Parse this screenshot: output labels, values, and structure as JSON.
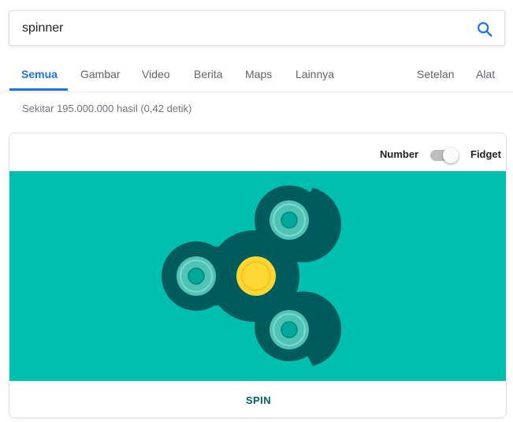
{
  "search": {
    "query": "spinner",
    "button_icon": "search-icon"
  },
  "tabs": [
    {
      "label": "Semua",
      "active": true
    },
    {
      "label": "Gambar"
    },
    {
      "label": "Video"
    },
    {
      "label": "Berita"
    },
    {
      "label": "Maps"
    },
    {
      "label": "Lainnya"
    }
  ],
  "tools": {
    "settings": "Setelan",
    "tools": "Alat"
  },
  "result_stats": "Sekitar 195.000.000 hasil (0,42 detik)",
  "spinner_widget": {
    "mode_left": "Number",
    "mode_right": "Fidget",
    "selected_mode": "Fidget",
    "spin_label": "SPIN",
    "colors": {
      "background": "#00bfae",
      "body": "#005c5c",
      "bearing_outer": "#4fc3b6",
      "bearing_inner": "#00a99a",
      "center": "#fdd835",
      "accent": "#1a73e8"
    }
  }
}
